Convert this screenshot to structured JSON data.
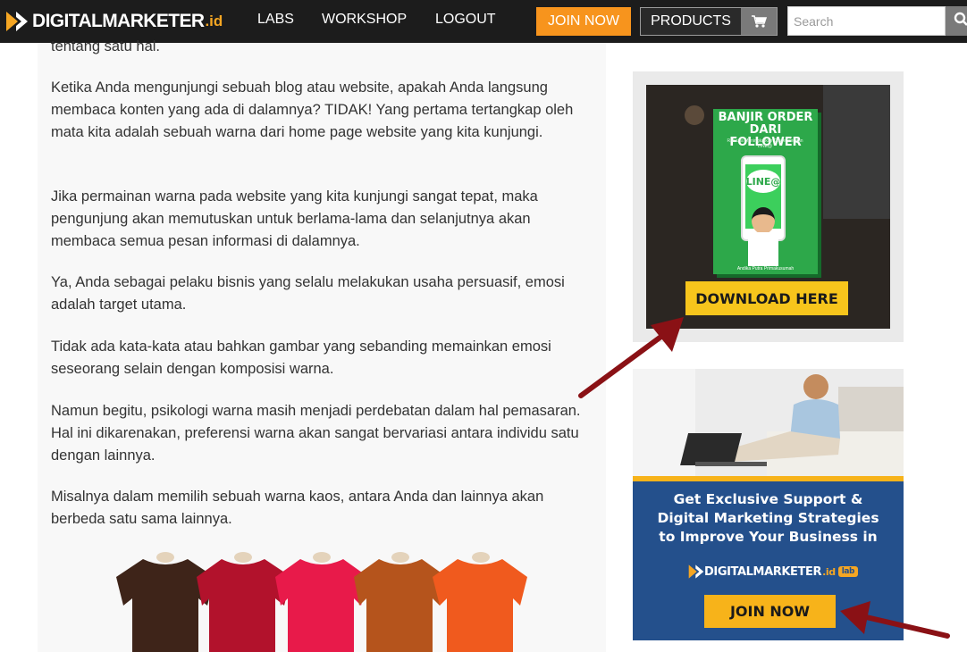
{
  "navbar": {
    "brand": "DIGITALMARKETER",
    "brand_suffix": ".id",
    "links": [
      "LABS",
      "WORKSHOP",
      "LOGOUT"
    ],
    "join_label": "JOIN NOW",
    "products_label": "PRODUCTS",
    "search_placeholder": "Search",
    "accent_color": "#f7941d"
  },
  "article": {
    "paragraphs": [
      "tentang satu hal.",
      "Ketika Anda mengunjungi sebuah blog atau website, apakah Anda langsung membaca konten yang ada di dalamnya? TIDAK! Yang pertama tertangkap oleh mata kita adalah sebuah warna dari home page website yang kita kunjungi.",
      "Jika permainan warna pada website yang kita kunjungi sangat tepat, maka pengunjung akan memutuskan untuk berlama-lama dan selanjutnya akan membaca semua pesan informasi di dalamnya.",
      "Ya, Anda sebagai pelaku bisnis yang selalu melakukan usaha persuasif, emosi adalah target utama.",
      "Tidak ada kata-kata atau bahkan gambar yang sebanding memainkan emosi seseorang selain dengan komposisi warna.",
      "Namun begitu, psikologi warna masih menjadi perdebatan dalam hal pemasaran. Hal ini dikarenakan, preferensi warna akan sangat bervariasi antara individu satu dengan lainnya.",
      "Misalnya dalam memilih sebuah warna kaos, antara Anda dan lainnya akan berbeda satu sama lainnya."
    ],
    "shirt_colors": [
      "#3e2419",
      "#b2122c",
      "#e81a4a",
      "#b5541c",
      "#f05a1e"
    ]
  },
  "sidebar": {
    "ad1": {
      "book_title": "BANJIR ORDER DARI FOLLOWER",
      "book_subtitle": "Rahasia Meningkatkan Omset dengan LINE@",
      "line_badge": "LINE@",
      "author": "Andika Putra Primakusumah",
      "button": "DOWNLOAD HERE"
    },
    "ad2": {
      "headline_1": "Get Exclusive Support &",
      "headline_2": "Digital Marketing Strategies",
      "headline_3": "to Improve Your Business in",
      "logo": "DIGITALMARKETER",
      "logo_suffix": ".id",
      "logo_lab": "lab",
      "button": "JOIN NOW"
    }
  }
}
